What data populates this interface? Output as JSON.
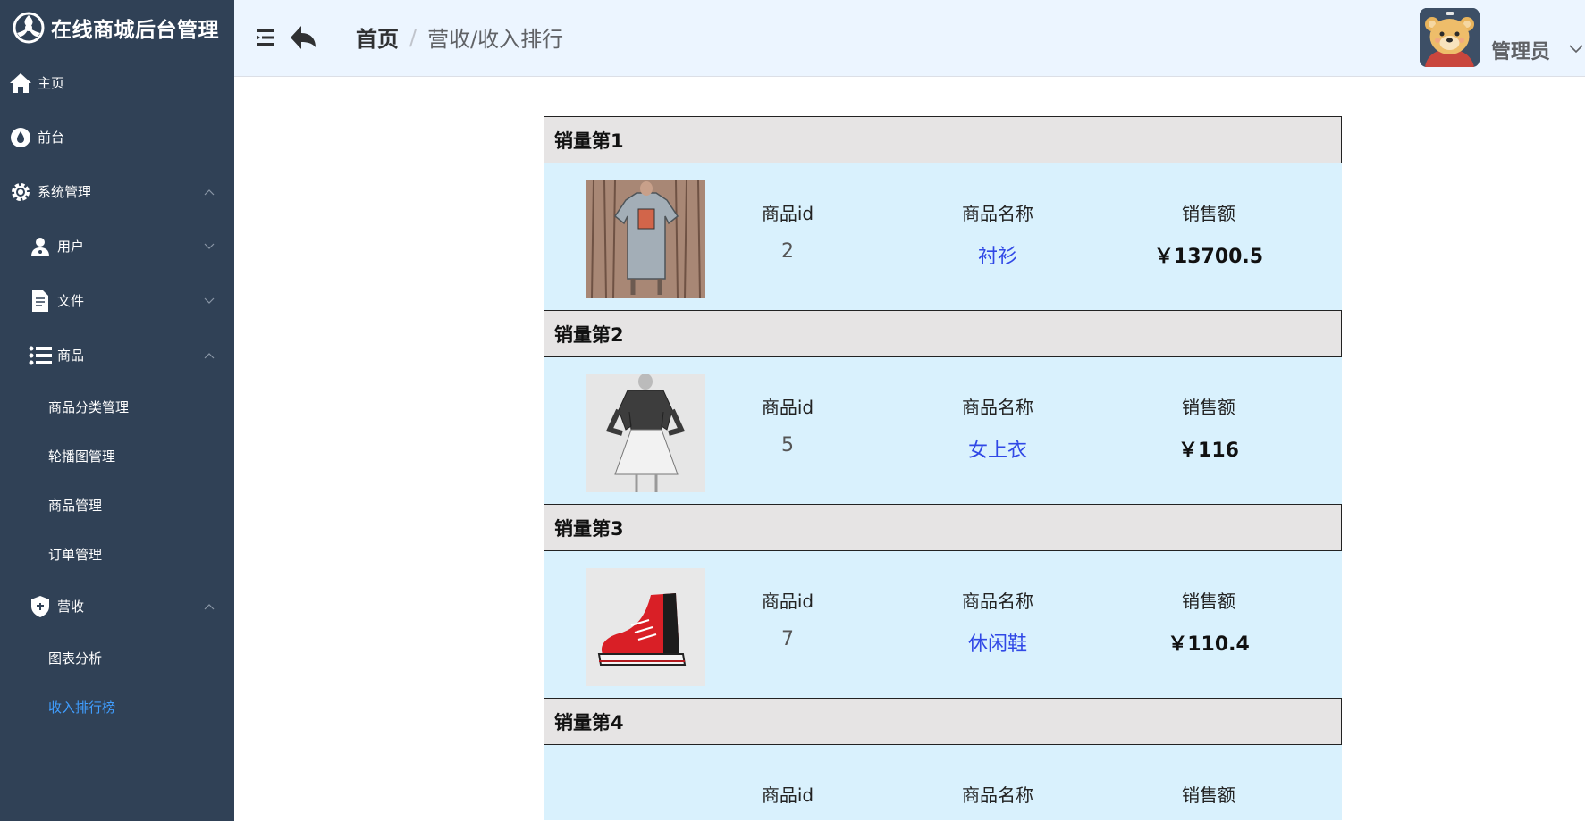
{
  "app": {
    "title": "在线商城后台管理"
  },
  "sidebar": {
    "items": [
      {
        "label": "主页",
        "icon": "home-icon"
      },
      {
        "label": "前台",
        "icon": "drop-icon"
      },
      {
        "label": "系统管理",
        "icon": "gear-icon"
      },
      {
        "label": "用户",
        "icon": "user-icon"
      },
      {
        "label": "文件",
        "icon": "file-icon"
      },
      {
        "label": "商品",
        "icon": "list-icon"
      },
      {
        "label": "商品分类管理"
      },
      {
        "label": "轮播图管理"
      },
      {
        "label": "商品管理"
      },
      {
        "label": "订单管理"
      },
      {
        "label": "营收",
        "icon": "shield-icon"
      },
      {
        "label": "图表分析"
      },
      {
        "label": "收入排行榜",
        "active": true
      }
    ]
  },
  "header": {
    "breadcrumb_home": "首页",
    "breadcrumb_sep": "/",
    "breadcrumb_current": "营收/收入排行",
    "user_name": "管理员"
  },
  "columns": {
    "id": "商品id",
    "name": "商品名称",
    "amount": "销售额"
  },
  "ranking": [
    {
      "title": "销量第1",
      "id": "2",
      "name": "衬衫",
      "amount": "￥13700.5",
      "image": "t-shirt"
    },
    {
      "title": "销量第2",
      "id": "5",
      "name": "女上衣",
      "amount": "￥116",
      "image": "blouse"
    },
    {
      "title": "销量第3",
      "id": "7",
      "name": "休闲鞋",
      "amount": "￥110.4",
      "image": "sneaker"
    },
    {
      "title": "销量第4"
    }
  ],
  "colors": {
    "sidebar_bg": "#304156",
    "active": "#409eff",
    "header_bg": "#ecf5ff",
    "row_bg": "#d9f1fd",
    "title_bg": "#e6e4e4",
    "link": "#3048e6"
  }
}
